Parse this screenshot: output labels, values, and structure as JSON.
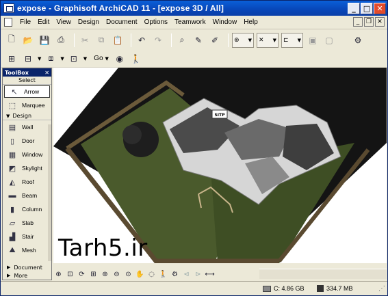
{
  "window": {
    "title": "expose - Graphisoft ArchiCAD 11 - [expose 3D / All]",
    "buttons": {
      "minimize": "_",
      "maximize": "□",
      "close": "✕"
    }
  },
  "menu": {
    "items": [
      "File",
      "Edit",
      "View",
      "Design",
      "Document",
      "Options",
      "Teamwork",
      "Window",
      "Help"
    ],
    "mdi": {
      "minimize": "_",
      "restore": "❐",
      "close": "✕"
    }
  },
  "toolbar2": {
    "go_label": "Go"
  },
  "toolbox": {
    "title": "ToolBox",
    "close": "✕",
    "select_header": "Select",
    "select_items": [
      {
        "label": "Arrow",
        "icon": "arrow-icon",
        "glyph": "↖"
      },
      {
        "label": "Marquee",
        "icon": "marquee-icon",
        "glyph": "⬚"
      }
    ],
    "design_header": "Design",
    "design_items": [
      {
        "label": "Wall",
        "icon": "wall-icon",
        "glyph": "▤"
      },
      {
        "label": "Door",
        "icon": "door-icon",
        "glyph": "▯"
      },
      {
        "label": "Window",
        "icon": "window-icon",
        "glyph": "▦"
      },
      {
        "label": "Skylight",
        "icon": "skylight-icon",
        "glyph": "◩"
      },
      {
        "label": "Roof",
        "icon": "roof-icon",
        "glyph": "◭"
      },
      {
        "label": "Beam",
        "icon": "beam-icon",
        "glyph": "▬"
      },
      {
        "label": "Column",
        "icon": "column-icon",
        "glyph": "▮"
      },
      {
        "label": "Slab",
        "icon": "slab-icon",
        "glyph": "▱"
      },
      {
        "label": "Stair",
        "icon": "stair-icon",
        "glyph": "▟"
      },
      {
        "label": "Mesh",
        "icon": "mesh-icon",
        "glyph": "⛰"
      }
    ],
    "footer": [
      "Document",
      "More"
    ]
  },
  "viewport": {
    "watermark": "Tarh5.ir",
    "sign_label": "SITP"
  },
  "status": {
    "disk": "C: 4.86 GB",
    "memory": "334.7 MB"
  },
  "colors": {
    "titlebar": "#0846b8",
    "chrome": "#ece9d8",
    "lawn": "#4a5a2c",
    "ground": "#1a1a1a"
  }
}
